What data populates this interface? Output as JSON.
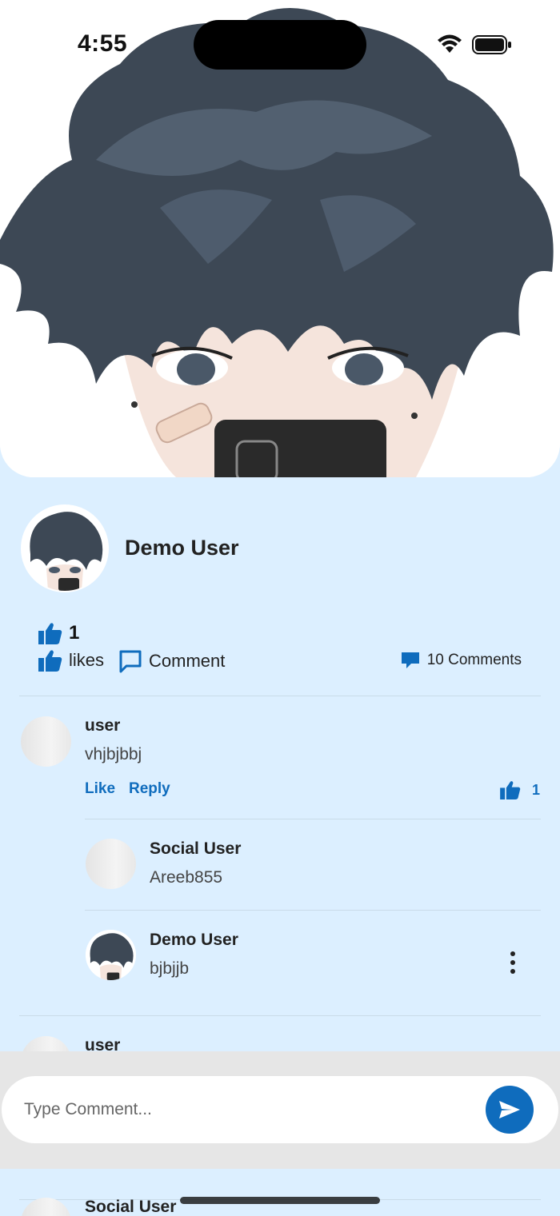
{
  "status_bar": {
    "time": "4:55"
  },
  "post": {
    "author": "Demo User",
    "like_count": "1",
    "likes_label": "likes",
    "comment_label": "Comment",
    "comments_count_label": "10 Comments"
  },
  "comments": [
    {
      "name": "user",
      "text": "vhjbjbbj",
      "like_label": "Like",
      "reply_label": "Reply",
      "likes": "1",
      "replies": [
        {
          "name": "Social User",
          "text": "Areeb855"
        },
        {
          "name": "Demo User",
          "text": "bjbjjb"
        }
      ]
    },
    {
      "name": "user"
    },
    {
      "name": "Social User"
    }
  ],
  "composer": {
    "placeholder": "Type Comment..."
  },
  "colors": {
    "accent": "#0f6cbd",
    "background": "#dcefff"
  }
}
